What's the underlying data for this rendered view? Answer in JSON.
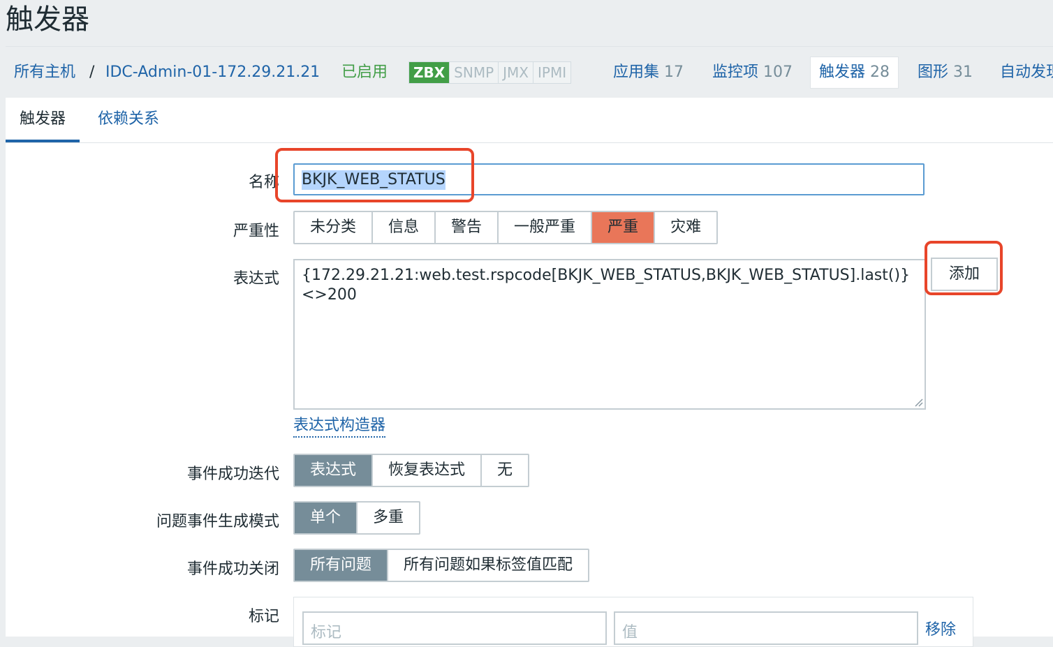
{
  "page": {
    "title": "触发器"
  },
  "navbar": {
    "all_hosts": "所有主机",
    "separator": "/",
    "host": "IDC-Admin-01-172.29.21.21",
    "status": "已启用",
    "availability": [
      "ZBX",
      "SNMP",
      "JMX",
      "IPMI"
    ],
    "links": [
      {
        "label": "应用集",
        "count": "17"
      },
      {
        "label": "监控项",
        "count": "107"
      },
      {
        "label": "触发器",
        "count": "28"
      },
      {
        "label": "图形",
        "count": "31"
      },
      {
        "label": "自动发现",
        "count": ""
      }
    ]
  },
  "tabs": [
    {
      "label": "触发器"
    },
    {
      "label": "依赖关系"
    }
  ],
  "form": {
    "name_label": "名称",
    "name_value": "BKJK_WEB_STATUS",
    "severity_label": "严重性",
    "severity_options": [
      "未分类",
      "信息",
      "警告",
      "一般严重",
      "严重",
      "灾难"
    ],
    "severity_selected": "严重",
    "expression_label": "表达式",
    "expression_value": "{172.29.21.21:web.test.rspcode[BKJK_WEB_STATUS,BKJK_WEB_STATUS].last()}<>200",
    "add_button": "添加",
    "builder_link": "表达式构造器",
    "ok_event_label": "事件成功迭代",
    "ok_event_options": [
      "表达式",
      "恢复表达式",
      "无"
    ],
    "ok_event_selected": "表达式",
    "problem_mode_label": "问题事件生成模式",
    "problem_mode_options": [
      "单个",
      "多重"
    ],
    "problem_mode_selected": "单个",
    "ok_close_label": "事件成功关闭",
    "ok_close_options": [
      "所有问题",
      "所有问题如果标签值匹配"
    ],
    "ok_close_selected": "所有问题",
    "tags_label": "标记",
    "tag_placeholder": "标记",
    "value_placeholder": "值",
    "remove_link": "移除"
  },
  "colors": {
    "link": "#1f64a8",
    "enabled_green": "#429e47",
    "severity_high": "#e97659",
    "selected_gray": "#768d99",
    "callout_red": "#e8452a"
  }
}
